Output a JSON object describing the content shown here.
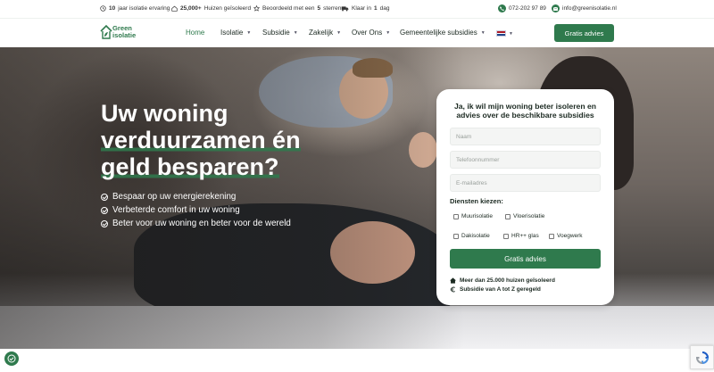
{
  "topbar": {
    "experience_prefix": "10",
    "experience_text": "jaar isolatie ervaring",
    "houses_prefix": "25,000+",
    "houses_text": "Huizen geïsoleerd",
    "rating_text": "Beoordeeld met een",
    "rating_value": "5",
    "rating_suffix": "sterren",
    "ready_text": "Klaar in",
    "ready_value": "1",
    "ready_suffix": "dag",
    "phone": "072-202 97 89",
    "email": "info@greenisolatie.nl"
  },
  "nav": {
    "logo_line1": "Green",
    "logo_line2": "isolatie",
    "items": [
      {
        "label": "Home",
        "active": true,
        "dropdown": false
      },
      {
        "label": "Isolatie",
        "active": false,
        "dropdown": true
      },
      {
        "label": "Subsidie",
        "active": false,
        "dropdown": true
      },
      {
        "label": "Zakelijk",
        "active": false,
        "dropdown": true
      },
      {
        "label": "Over Ons",
        "active": false,
        "dropdown": true
      },
      {
        "label": "Gemeentelijke subsidies",
        "active": false,
        "dropdown": true
      }
    ],
    "cta_label": "Gratis advies",
    "language": "NL"
  },
  "hero": {
    "heading_line1": "Uw woning",
    "heading_line2": "verduurzamen én",
    "heading_line3": "geld besparen?",
    "bullets": [
      "Bespaar op uw energierekening",
      "Verbeterde comfort in uw woning",
      "Beter voor uw woning en beter voor de wereld"
    ]
  },
  "form": {
    "title": "Ja, ik wil mijn woning beter isoleren en advies over de beschikbare subsidies",
    "name_placeholder": "Naam",
    "phone_placeholder": "Telefoonnummer",
    "email_placeholder": "E-mailadres",
    "services_label": "Diensten kiezen:",
    "services": [
      "Muurisolatie",
      "Vloerisolatie",
      "Dakisolatie",
      "HR++ glas",
      "Voegwerk"
    ],
    "submit_label": "Gratis advies",
    "usp1": "Meer dan 25.000 huizen geïsoleerd",
    "usp2": "Subsidie van A tot Z geregeld"
  },
  "colors": {
    "brand_green": "#2f7a4d",
    "text_dark": "#1c2a22",
    "white": "#ffffff"
  },
  "icons": [
    "clock-icon",
    "home-icon",
    "star-icon",
    "truck-icon",
    "phone-icon",
    "mail-icon",
    "check-circle-icon",
    "house-icon",
    "euro-icon",
    "cookie-icon",
    "recaptcha-icon"
  ]
}
